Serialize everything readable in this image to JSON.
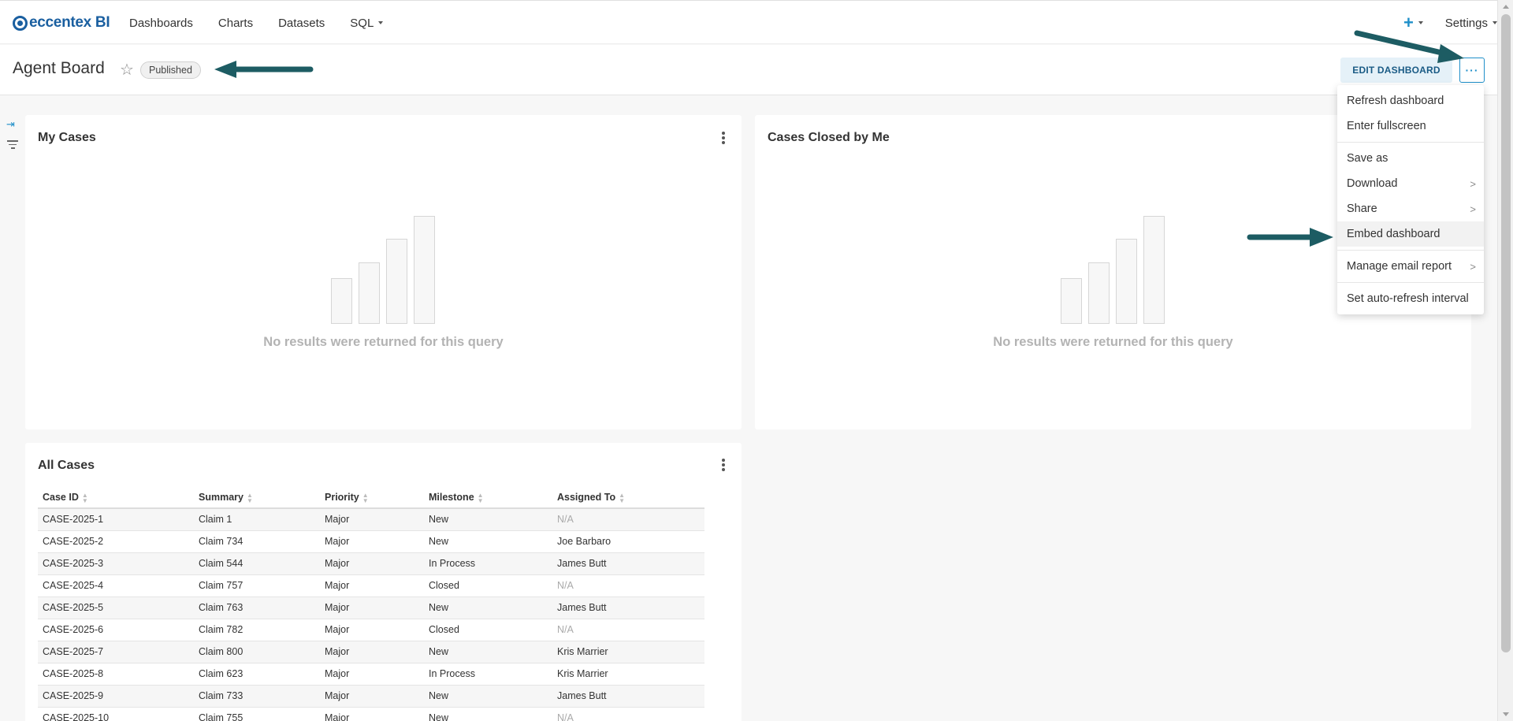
{
  "nav": {
    "logo_text": "eccentex BI",
    "links": [
      "Dashboards",
      "Charts",
      "Datasets",
      "SQL"
    ],
    "plus_label": "+",
    "settings_label": "Settings"
  },
  "header": {
    "title": "Agent Board",
    "badge": "Published",
    "edit_label": "EDIT DASHBOARD",
    "more_label": "···"
  },
  "charts": [
    {
      "title": "My Cases",
      "empty_message": "No results were returned for this query"
    },
    {
      "title": "Cases Closed by Me",
      "empty_message": "No results were returned for this query"
    }
  ],
  "table": {
    "title": "All Cases",
    "columns": [
      "Case ID",
      "Summary",
      "Priority",
      "Milestone",
      "Assigned To"
    ],
    "rows": [
      [
        "CASE-2025-1",
        "Claim 1",
        "Major",
        "New",
        "N/A"
      ],
      [
        "CASE-2025-2",
        "Claim 734",
        "Major",
        "New",
        "Joe Barbaro"
      ],
      [
        "CASE-2025-3",
        "Claim 544",
        "Major",
        "In Process",
        "James Butt"
      ],
      [
        "CASE-2025-4",
        "Claim 757",
        "Major",
        "Closed",
        "N/A"
      ],
      [
        "CASE-2025-5",
        "Claim 763",
        "Major",
        "New",
        "James Butt"
      ],
      [
        "CASE-2025-6",
        "Claim 782",
        "Major",
        "Closed",
        "N/A"
      ],
      [
        "CASE-2025-7",
        "Claim 800",
        "Major",
        "New",
        "Kris Marrier"
      ],
      [
        "CASE-2025-8",
        "Claim 623",
        "Major",
        "In Process",
        "Kris Marrier"
      ],
      [
        "CASE-2025-9",
        "Claim 733",
        "Major",
        "New",
        "James Butt"
      ],
      [
        "CASE-2025-10",
        "Claim 755",
        "Major",
        "New",
        "N/A"
      ]
    ]
  },
  "menu": {
    "items": [
      {
        "label": "Refresh dashboard",
        "submenu": false
      },
      {
        "label": "Enter fullscreen",
        "submenu": false
      },
      {
        "divider": true
      },
      {
        "label": "Save as",
        "submenu": false
      },
      {
        "label": "Download",
        "submenu": true
      },
      {
        "label": "Share",
        "submenu": true
      },
      {
        "label": "Embed dashboard",
        "submenu": false,
        "active": true
      },
      {
        "divider": true
      },
      {
        "label": "Manage email report",
        "submenu": true
      },
      {
        "divider": true
      },
      {
        "label": "Set auto-refresh interval",
        "submenu": false
      }
    ]
  },
  "colors": {
    "brand": "#1a5fa0",
    "accent": "#1f8fc9",
    "annotation_arrow": "#1d5c63"
  }
}
